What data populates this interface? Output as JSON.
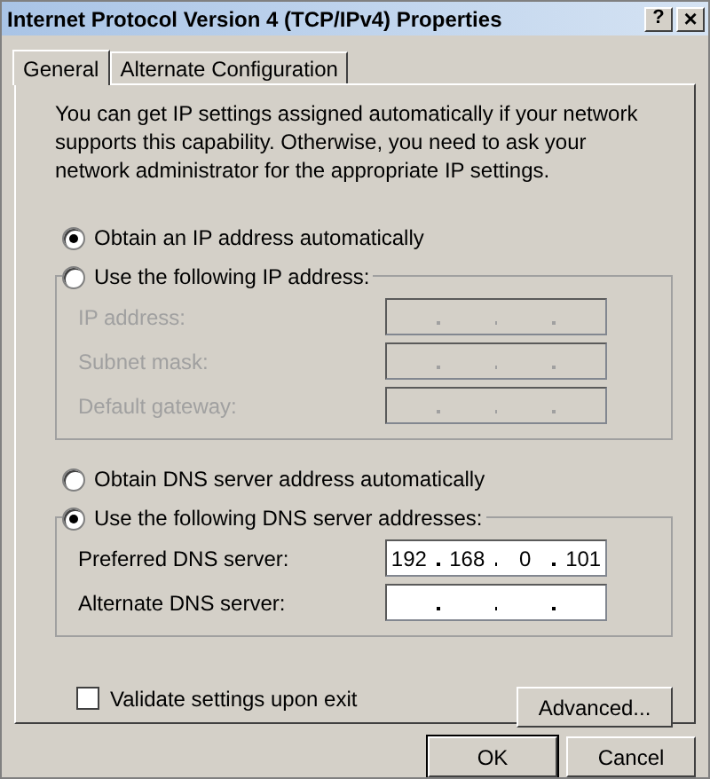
{
  "window": {
    "title": "Internet Protocol Version 4 (TCP/IPv4) Properties",
    "help_button": "?",
    "close_button": "×"
  },
  "tabs": [
    {
      "label": "General",
      "selected": true
    },
    {
      "label": "Alternate Configuration",
      "selected": false
    }
  ],
  "description": "You can get IP settings assigned automatically if your network supports this capability. Otherwise, you need to ask your network administrator for the appropriate IP settings.",
  "ip_section": {
    "auto_option": {
      "label": "Obtain an IP address automatically",
      "selected": true
    },
    "manual_option": {
      "label": "Use the following IP address:",
      "selected": false
    },
    "disabled": true,
    "fields": [
      {
        "label": "IP address:"
      },
      {
        "label": "Subnet mask:"
      },
      {
        "label": "Default gateway:"
      }
    ]
  },
  "dns_section": {
    "auto_option": {
      "label": "Obtain DNS server address automatically",
      "selected": false
    },
    "manual_option": {
      "label": "Use the following DNS server addresses:",
      "selected": true
    },
    "disabled": false,
    "fields": [
      {
        "label": "Preferred DNS server:",
        "octets": [
          "192",
          "168",
          "0",
          "101"
        ]
      },
      {
        "label": "Alternate DNS server:"
      }
    ]
  },
  "validate": {
    "label": "Validate settings upon exit",
    "checked": false
  },
  "advanced_button": "Advanced...",
  "buttons": [
    "OK",
    "Cancel"
  ]
}
